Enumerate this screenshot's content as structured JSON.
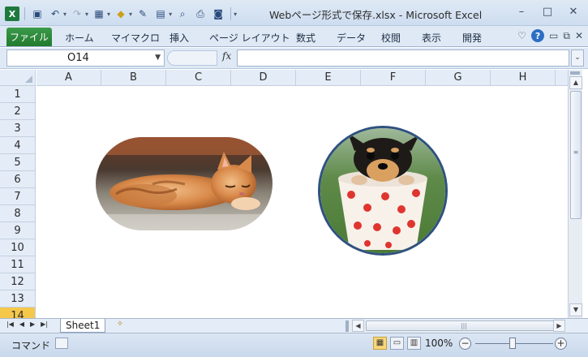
{
  "window": {
    "title": "Webページ形式で保存.xlsx  -  Microsoft Excel",
    "controls": [
      "–",
      "□",
      "✕"
    ]
  },
  "ribbon": {
    "tabs": [
      "ファイル",
      "ホーム",
      "マイマクロ",
      "挿入",
      "ページ レイアウト",
      "数式",
      "データ",
      "校閲",
      "表示",
      "開発"
    ]
  },
  "formula_bar": {
    "name_box": "O14",
    "fx": "fx",
    "formula": ""
  },
  "sheet": {
    "columns": [
      "A",
      "B",
      "C",
      "D",
      "E",
      "F",
      "G",
      "H"
    ],
    "rows": [
      "1",
      "2",
      "3",
      "4",
      "5",
      "6",
      "7",
      "8",
      "9",
      "10",
      "11",
      "12",
      "13",
      "14"
    ],
    "active_row": "14"
  },
  "sheet_tabs": {
    "tabs": [
      "Sheet1"
    ]
  },
  "status": {
    "mode": "コマンド",
    "zoom": "100%"
  },
  "colors": {
    "title_bar": "#dfe9f5",
    "file_tab": "#217a2e",
    "active_row_header": "#f5c84a",
    "picture_border": "#2f527f"
  },
  "icons": {
    "qat": [
      "excel-logo-icon",
      "save-icon",
      "undo-icon",
      "redo-icon",
      "borders-icon",
      "fill-color-icon",
      "format-painter-icon",
      "paste-icon",
      "print-preview-icon",
      "print-icon",
      "camera-icon",
      "customize-qat-icon"
    ]
  }
}
